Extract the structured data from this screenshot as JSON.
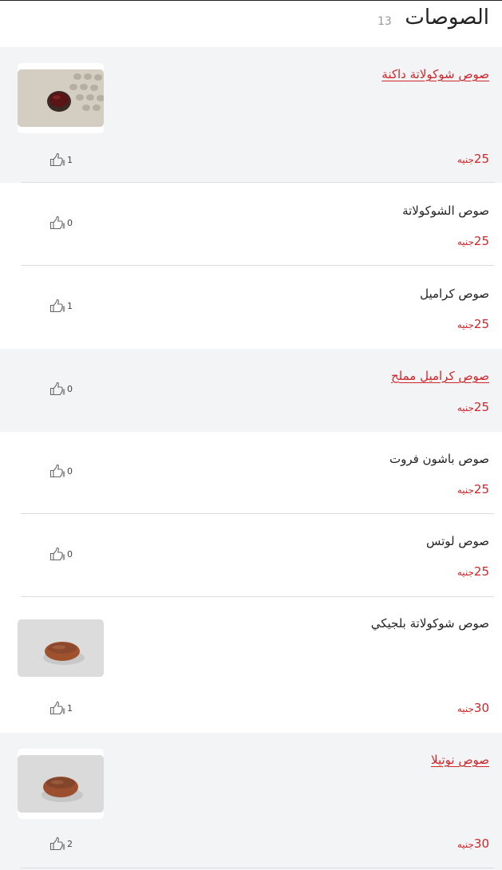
{
  "header": {
    "title": "الصوصات",
    "count": "13"
  },
  "currency": "جنيه",
  "items": [
    {
      "name": "صوص شوكولاتة داكنة",
      "price": "25",
      "likes": "1"
    },
    {
      "name": "صوص الشوكولاتة",
      "price": "25",
      "likes": "0"
    },
    {
      "name": "صوص كراميل",
      "price": "25",
      "likes": "1"
    },
    {
      "name": "صوص كراميل مملح",
      "price": "25",
      "likes": "0"
    },
    {
      "name": "صوص باشون فروت",
      "price": "25",
      "likes": "0"
    },
    {
      "name": "صوص لوتس",
      "price": "25",
      "likes": "0"
    },
    {
      "name": "صوص شوكولاتة بلجيكي",
      "price": "30",
      "likes": "1"
    },
    {
      "name": "صوص نوتيلا",
      "price": "30",
      "likes": "2"
    }
  ],
  "colors": {
    "accent": "#d0262a",
    "gray_row": "#f3f4f6",
    "divider": "#dadde1"
  },
  "icons": {
    "like": "thumbs-up-icon"
  }
}
